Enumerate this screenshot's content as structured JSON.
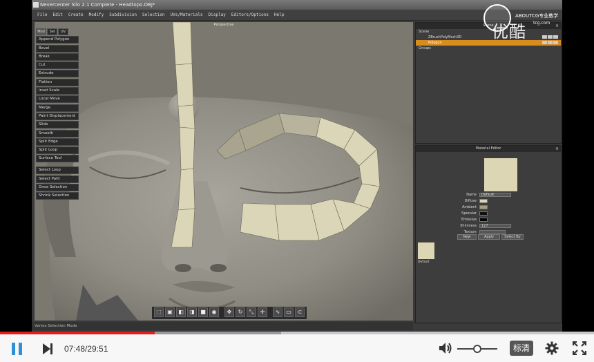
{
  "window": {
    "title": "Nevercenter Silo 2.1 Complete - Headtopo.OBJ*",
    "menu": [
      "File",
      "Edit",
      "Create",
      "Modify",
      "Subdivision",
      "Selection",
      "UVs/Materials",
      "Display",
      "Editors/Options",
      "Help"
    ]
  },
  "viewport": {
    "label": "Perspective"
  },
  "tool_panel": {
    "tabs": [
      "Mod",
      "Sel",
      "UV"
    ],
    "active_tab": "Mod",
    "tools": [
      "Append Polygon",
      "Bevel",
      "Break",
      "Cut",
      "Extrude",
      "Flatten",
      "Inset Scale",
      "Local Move",
      "Merge",
      "Paint Displacement",
      "Slide",
      "Smooth",
      "Split Edge",
      "Split Loop",
      "Surface Tool"
    ],
    "select_tools": [
      "Select Loop",
      "Select Path",
      "Grow Selection",
      "Shrink Selection"
    ]
  },
  "status": {
    "text": "Vertex Selection Mode"
  },
  "scene_panel": {
    "title": "Scene",
    "rows": [
      {
        "label": "Scene",
        "indent": 0,
        "selected": false
      },
      {
        "label": "ZBrushPolyMesh3D",
        "indent": 2,
        "selected": false
      },
      {
        "label": "Polygon",
        "indent": 2,
        "selected": true
      },
      {
        "label": "Groups",
        "indent": 0,
        "selected": false
      }
    ]
  },
  "material_editor": {
    "title": "Material Editor",
    "name_label": "Name",
    "name_value": "Default",
    "diffuse_label": "Diffuse",
    "ambient_label": "Ambient",
    "specular_label": "Specular",
    "emissive_label": "Emissive",
    "shininess_label": "Shininess",
    "shininess_value": "127",
    "texture_label": "Texture",
    "buttons": [
      "New",
      "Apply",
      "Select By"
    ],
    "thumb_label": "Default",
    "colors": {
      "diffuse": "#ddd6b4",
      "ambient": "#a89f80",
      "specular": "#111111",
      "emissive": "#000000"
    }
  },
  "watermark": {
    "brand": "优酷",
    "line1": "ABOUTCG专业教学",
    "line2": "tcg.com"
  },
  "player": {
    "current_time": "07:48",
    "total_time": "29:51",
    "time_display": "07:48/29:51",
    "progress_fraction": 0.261,
    "buffered_fraction": 0.473,
    "volume_fraction": 0.5,
    "quality_label": "标清",
    "accent_color": "#e0201f"
  },
  "icons": {
    "pause": "pause-icon",
    "next": "next-icon",
    "volume": "volume-icon",
    "settings": "gear-icon",
    "fullscreen": "fullscreen-icon"
  }
}
